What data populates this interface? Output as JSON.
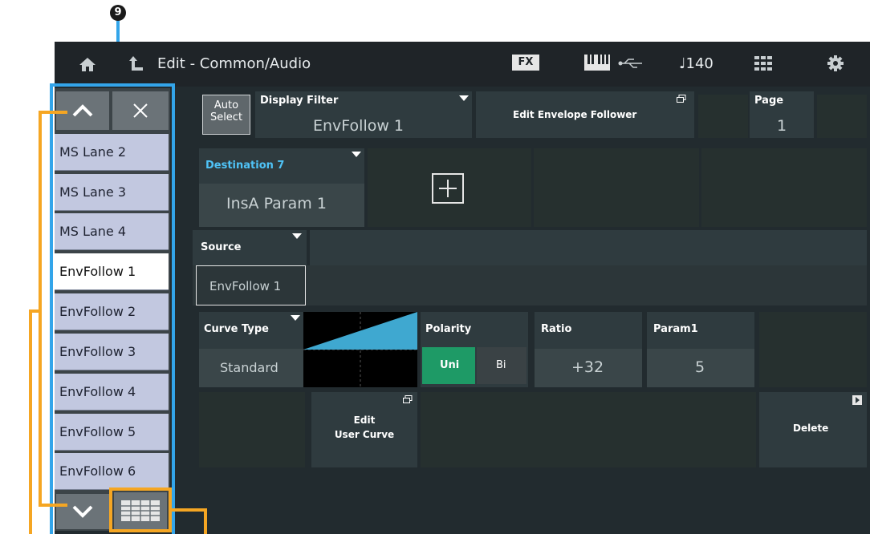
{
  "callout": {
    "number": "9"
  },
  "topbar": {
    "title": "Edit - Common/Audio",
    "fx_label": "FX",
    "tempo": "♩140"
  },
  "auto_select": {
    "line1": "Auto",
    "line2": "Select"
  },
  "display_filter": {
    "label": "Display Filter",
    "value": "EnvFollow 1"
  },
  "edit_env": {
    "label": "Edit Envelope Follower"
  },
  "page": {
    "label": "Page",
    "value": "1"
  },
  "destination": {
    "label": "Destination 7",
    "value": "InsA Param 1"
  },
  "source": {
    "label": "Source",
    "value": "EnvFollow 1"
  },
  "curve_type": {
    "label": "Curve Type",
    "value": "Standard"
  },
  "polarity": {
    "label": "Polarity",
    "uni": "Uni",
    "bi": "Bi"
  },
  "ratio": {
    "label": "Ratio",
    "value": "+32"
  },
  "param1": {
    "label": "Param1",
    "value": "5"
  },
  "edit_user_curve": {
    "line1": "Edit",
    "line2": "User Curve"
  },
  "delete": {
    "label": "Delete"
  },
  "list": {
    "items": [
      "MS Lane 2",
      "MS Lane 3",
      "MS Lane 4",
      "EnvFollow 1",
      "EnvFollow 2",
      "EnvFollow 3",
      "EnvFollow 4",
      "EnvFollow 5",
      "EnvFollow 6"
    ],
    "selected_index": 3
  },
  "colors": {
    "callout_blue": "#33a5ea",
    "callout_orange": "#f5a623",
    "uni_green": "#1e9a66",
    "destination_blue": "#4fc3f7"
  }
}
